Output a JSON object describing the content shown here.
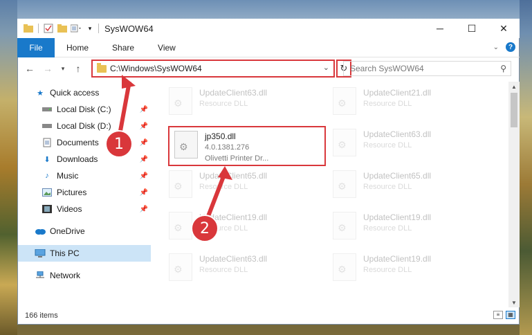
{
  "window": {
    "title": "SysWOW64",
    "controls": {
      "minimize": "─",
      "maximize": "☐",
      "close": "✕"
    }
  },
  "ribbon": {
    "tabs": [
      "File",
      "Home",
      "Share",
      "View"
    ],
    "help": "?"
  },
  "address_bar": {
    "path": "C:\\Windows\\SysWOW64",
    "refresh": "↻"
  },
  "search": {
    "placeholder": "Search SysWOW64"
  },
  "sidebar": {
    "quick_access": "Quick access",
    "items": [
      {
        "label": "Local Disk (C:)",
        "icon": "drive-icon"
      },
      {
        "label": "Local Disk (D:)",
        "icon": "drive-icon"
      },
      {
        "label": "Documents",
        "icon": "documents-icon"
      },
      {
        "label": "Downloads",
        "icon": "downloads-icon"
      },
      {
        "label": "Music",
        "icon": "music-icon"
      },
      {
        "label": "Pictures",
        "icon": "pictures-icon"
      },
      {
        "label": "Videos",
        "icon": "videos-icon"
      }
    ],
    "onedrive": "OneDrive",
    "this_pc": "This PC",
    "network": "Network"
  },
  "files": {
    "left": [
      {
        "name": "UpdateClient63.dll",
        "sub": "Resource DLL"
      },
      {
        "name": "UpdateClient65.dll",
        "sub": "Resource DLL"
      },
      {
        "name": "UpdateClient19.dll",
        "sub": "Resource DLL"
      },
      {
        "name": "UpdateClient63.dll",
        "sub": "Resource DLL"
      }
    ],
    "right": [
      {
        "name": "UpdateClient21.dll",
        "sub": "Resource DLL"
      },
      {
        "name": "UpdateClient63.dll",
        "sub": "Resource DLL"
      },
      {
        "name": "UpdateClient65.dll",
        "sub": "Resource DLL"
      },
      {
        "name": "UpdateClient19.dll",
        "sub": "Resource DLL"
      },
      {
        "name": "UpdateClient19.dll",
        "sub": "Resource DLL"
      }
    ],
    "target": {
      "name": "jp350.dll",
      "version": "4.0.1381.276",
      "description": "Olivetti Printer Dr..."
    }
  },
  "status": {
    "count": "166 items"
  },
  "annotations": {
    "step1": "1",
    "step2": "2",
    "color": "#d9373b"
  }
}
